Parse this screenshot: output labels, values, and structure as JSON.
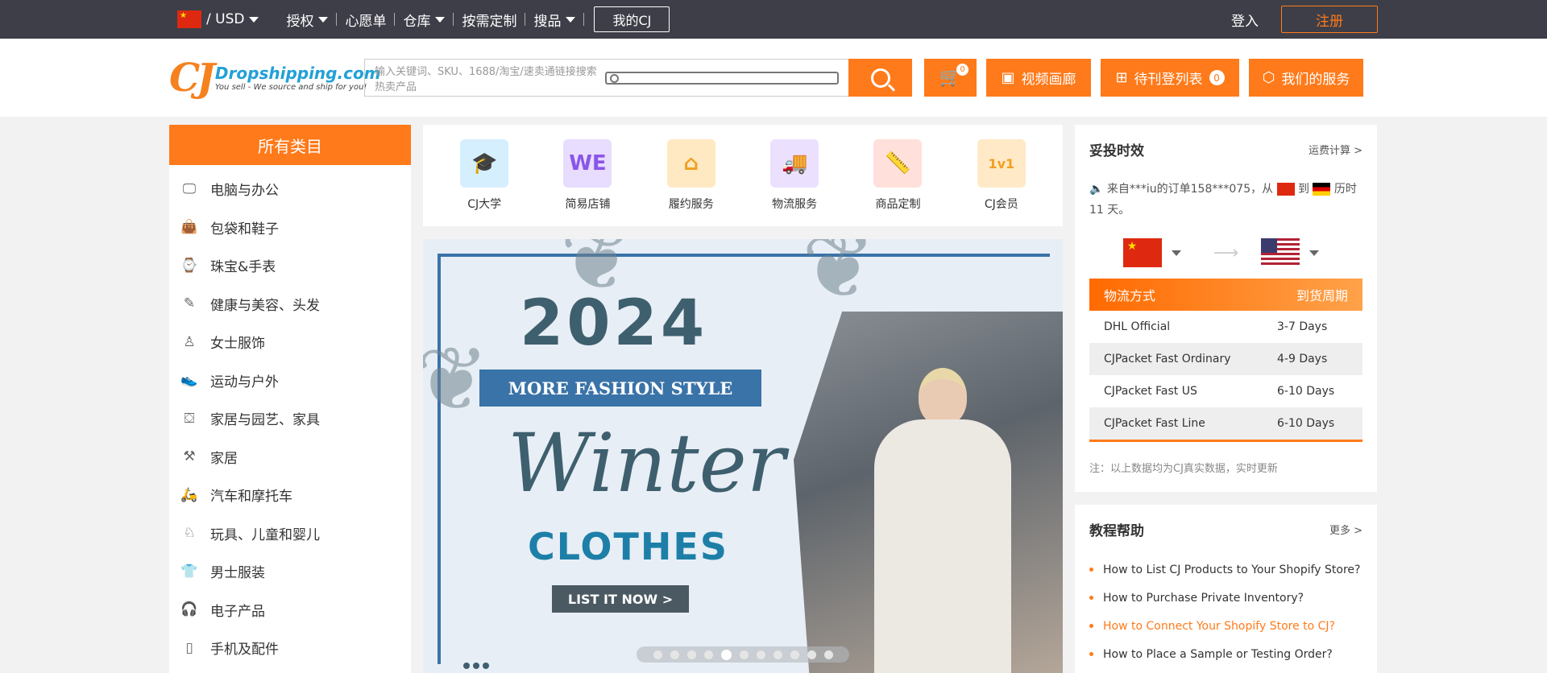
{
  "topbar": {
    "currency": "/ USD",
    "menu": [
      "授权",
      "心愿单",
      "仓库",
      "按需定制",
      "搜品"
    ],
    "my_cj": "我的CJ",
    "login": "登入",
    "register": "注册"
  },
  "header": {
    "logo_mark": "CJ",
    "logo_main": "Dropshipping.com",
    "logo_sub": "You sell - We source and ship for you!",
    "search_placeholder": "输入关键词、SKU、1688/淘宝/速卖通链接搜索热卖产品",
    "cart_count": "0",
    "video_gallery": "视频画廊",
    "pending_list": "待刊登列表",
    "pending_count": "0",
    "our_services": "我们的服务"
  },
  "sidebar": {
    "title": "所有类目",
    "items": [
      {
        "label": "电脑与办公",
        "icon": "computer-icon"
      },
      {
        "label": "包袋和鞋子",
        "icon": "bag-icon"
      },
      {
        "label": "珠宝&手表",
        "icon": "watch-icon"
      },
      {
        "label": "健康与美容、头发",
        "icon": "brush-icon"
      },
      {
        "label": "女士服饰",
        "icon": "dress-icon"
      },
      {
        "label": "运动与户外",
        "icon": "shoe-icon"
      },
      {
        "label": "家居与园艺、家具",
        "icon": "furniture-icon"
      },
      {
        "label": "家居",
        "icon": "paint-roller-icon"
      },
      {
        "label": "汽车和摩托车",
        "icon": "motorcycle-icon"
      },
      {
        "label": "玩具、儿童和婴儿",
        "icon": "rocking-horse-icon"
      },
      {
        "label": "男士服装",
        "icon": "tshirt-icon"
      },
      {
        "label": "电子产品",
        "icon": "headphones-icon"
      },
      {
        "label": "手机及配件",
        "icon": "phone-icon"
      }
    ]
  },
  "services": [
    {
      "label": "CJ大学",
      "icon": "graduation-cap-icon",
      "color": "#4aa8e0",
      "bg": "#d6efff"
    },
    {
      "label": "简易店铺",
      "icon": "store-we-icon",
      "color": "#8a56e8",
      "bg": "#e8dcff"
    },
    {
      "label": "履约服务",
      "icon": "house-icon",
      "color": "#f0a020",
      "bg": "#ffe9c2"
    },
    {
      "label": "物流服务",
      "icon": "truck-icon",
      "color": "#9a6ae8",
      "bg": "#ece0ff"
    },
    {
      "label": "商品定制",
      "icon": "ruler-icon",
      "color": "#f07060",
      "bg": "#ffe0da"
    },
    {
      "label": "CJ会员",
      "icon": "vip-diamond-icon",
      "color": "#f0a020",
      "bg": "#ffe9c6"
    }
  ],
  "banner": {
    "year": "2024",
    "ribbon": "MORE FASHION STYLE",
    "headline": "Winter",
    "subheadline": "CLOTHES",
    "cta": "LIST IT NOW >",
    "slide_count": 11,
    "active_slide": 5
  },
  "delivery": {
    "title": "妥投时效",
    "calc": "运费计算 >",
    "notice_pre": "来自***iu的订单158***075，从",
    "notice_to": "到",
    "notice_post": "历时11 天。",
    "col_method": "物流方式",
    "col_period": "到货周期",
    "rows": [
      {
        "method": "DHL Official",
        "period": "3-7 Days"
      },
      {
        "method": "CJPacket Fast Ordinary",
        "period": "4-9 Days"
      },
      {
        "method": "CJPacket Fast US",
        "period": "6-10 Days"
      },
      {
        "method": "CJPacket Fast Line",
        "period": "6-10 Days"
      }
    ],
    "note": "注：以上数据均为CJ真实数据，实时更新"
  },
  "tutorial": {
    "title": "教程帮助",
    "more": "更多 >",
    "items": [
      "How to List CJ Products to Your Shopify Store?",
      "How to Purchase Private Inventory?",
      "How to Connect Your Shopify Store to CJ?",
      "How to Place a Sample or Testing Order?"
    ],
    "highlight_index": 2
  },
  "colors": {
    "accent": "#ff7a1a",
    "topbar": "#3d3e48",
    "brand_blue": "#22a0d6"
  }
}
